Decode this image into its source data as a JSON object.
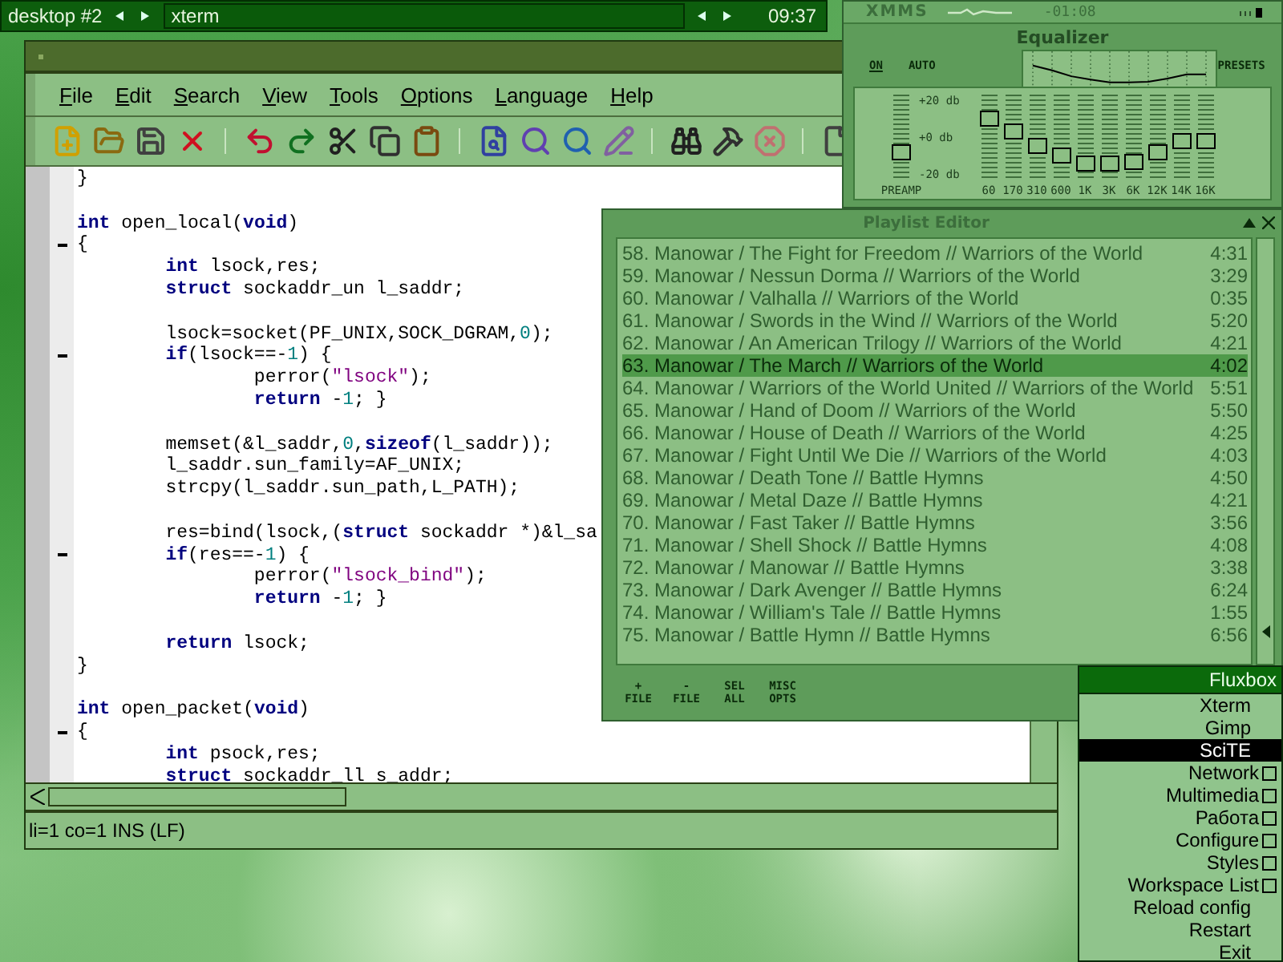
{
  "taskbar": {
    "workspace": "desktop #2",
    "task": "xterm",
    "clock": "09:37"
  },
  "editor": {
    "menu": [
      "File",
      "Edit",
      "Search",
      "View",
      "Tools",
      "Options",
      "Language",
      "Help"
    ],
    "lines": [
      {
        "kind": "code",
        "fold": false,
        "segments": [
          {
            "kind": "plain",
            "text": "}"
          }
        ]
      },
      {
        "kind": "blank",
        "fold": false
      },
      {
        "kind": "code",
        "fold": false,
        "segments": [
          {
            "kind": "kw",
            "text": "int"
          },
          {
            "kind": "plain",
            "text": " open_local("
          },
          {
            "kind": "kw",
            "text": "void"
          },
          {
            "kind": "plain",
            "text": ")"
          }
        ]
      },
      {
        "kind": "code",
        "fold": true,
        "segments": [
          {
            "kind": "plain",
            "text": "{"
          }
        ]
      },
      {
        "kind": "code",
        "fold": false,
        "segments": [
          {
            "kind": "kw",
            "text": "        int"
          },
          {
            "kind": "plain",
            "text": " lsock,res;"
          }
        ]
      },
      {
        "kind": "code",
        "fold": false,
        "segments": [
          {
            "kind": "kw",
            "text": "        struct"
          },
          {
            "kind": "plain",
            "text": " sockaddr_un l_saddr;"
          }
        ]
      },
      {
        "kind": "blank",
        "fold": false
      },
      {
        "kind": "code",
        "fold": false,
        "segments": [
          {
            "kind": "plain",
            "text": "        lsock=socket(PF_UNIX,SOCK_DGRAM,"
          },
          {
            "kind": "num",
            "text": "0"
          },
          {
            "kind": "plain",
            "text": ");"
          }
        ]
      },
      {
        "kind": "code",
        "fold": true,
        "segments": [
          {
            "kind": "kw",
            "text": "        if"
          },
          {
            "kind": "plain",
            "text": "(lsock==-"
          },
          {
            "kind": "num",
            "text": "1"
          },
          {
            "kind": "plain",
            "text": ") {"
          }
        ]
      },
      {
        "kind": "code",
        "fold": false,
        "segments": [
          {
            "kind": "plain",
            "text": "                perror("
          },
          {
            "kind": "str",
            "text": "\"lsock\""
          },
          {
            "kind": "plain",
            "text": ");"
          }
        ]
      },
      {
        "kind": "code",
        "fold": false,
        "segments": [
          {
            "kind": "kw",
            "text": "                return"
          },
          {
            "kind": "plain",
            "text": " -"
          },
          {
            "kind": "num",
            "text": "1"
          },
          {
            "kind": "plain",
            "text": "; }"
          }
        ]
      },
      {
        "kind": "blank",
        "fold": false
      },
      {
        "kind": "code",
        "fold": false,
        "segments": [
          {
            "kind": "plain",
            "text": "        memset(&l_saddr,"
          },
          {
            "kind": "num",
            "text": "0"
          },
          {
            "kind": "plain",
            "text": ","
          },
          {
            "kind": "kw",
            "text": "sizeof"
          },
          {
            "kind": "plain",
            "text": "(l_saddr));"
          }
        ]
      },
      {
        "kind": "code",
        "fold": false,
        "segments": [
          {
            "kind": "plain",
            "text": "        l_saddr.sun_family=AF_UNIX;"
          }
        ]
      },
      {
        "kind": "code",
        "fold": false,
        "segments": [
          {
            "kind": "plain",
            "text": "        strcpy(l_saddr.sun_path,L_PATH);"
          }
        ]
      },
      {
        "kind": "blank",
        "fold": false
      },
      {
        "kind": "code",
        "fold": false,
        "segments": [
          {
            "kind": "plain",
            "text": "        res=bind(lsock,("
          },
          {
            "kind": "kw",
            "text": "struct"
          },
          {
            "kind": "plain",
            "text": " sockaddr *)&l_sa"
          }
        ]
      },
      {
        "kind": "code",
        "fold": true,
        "segments": [
          {
            "kind": "kw",
            "text": "        if"
          },
          {
            "kind": "plain",
            "text": "(res==-"
          },
          {
            "kind": "num",
            "text": "1"
          },
          {
            "kind": "plain",
            "text": ") {"
          }
        ]
      },
      {
        "kind": "code",
        "fold": false,
        "segments": [
          {
            "kind": "plain",
            "text": "                perror("
          },
          {
            "kind": "str",
            "text": "\"lsock_bind\""
          },
          {
            "kind": "plain",
            "text": ");"
          }
        ]
      },
      {
        "kind": "code",
        "fold": false,
        "segments": [
          {
            "kind": "kw",
            "text": "                return"
          },
          {
            "kind": "plain",
            "text": " -"
          },
          {
            "kind": "num",
            "text": "1"
          },
          {
            "kind": "plain",
            "text": "; }"
          }
        ]
      },
      {
        "kind": "blank",
        "fold": false
      },
      {
        "kind": "code",
        "fold": false,
        "segments": [
          {
            "kind": "kw",
            "text": "        return"
          },
          {
            "kind": "plain",
            "text": " lsock;"
          }
        ]
      },
      {
        "kind": "code",
        "fold": false,
        "segments": [
          {
            "kind": "plain",
            "text": "}"
          }
        ]
      },
      {
        "kind": "blank",
        "fold": false
      },
      {
        "kind": "code",
        "fold": false,
        "segments": [
          {
            "kind": "kw",
            "text": "int"
          },
          {
            "kind": "plain",
            "text": " open_packet("
          },
          {
            "kind": "kw",
            "text": "void"
          },
          {
            "kind": "plain",
            "text": ")"
          }
        ]
      },
      {
        "kind": "code",
        "fold": true,
        "segments": [
          {
            "kind": "plain",
            "text": "{"
          }
        ]
      },
      {
        "kind": "code",
        "fold": false,
        "segments": [
          {
            "kind": "kw",
            "text": "        int"
          },
          {
            "kind": "plain",
            "text": " psock,res;"
          }
        ]
      },
      {
        "kind": "code",
        "fold": false,
        "segments": [
          {
            "kind": "kw",
            "text": "        struct"
          },
          {
            "kind": "plain",
            "text": " sockaddr_ll s_addr;"
          }
        ]
      }
    ],
    "status": "li=1 co=1 INS (LF)"
  },
  "xmms": {
    "title": "XMMS",
    "time": "-01:08",
    "equalizer": {
      "title": "Equalizer",
      "on_label": "ON",
      "on": true,
      "auto_label": "AUTO",
      "auto": false,
      "presets_label": "PRESETS",
      "scale": [
        "+20 db",
        "+0 db",
        "-20 db"
      ],
      "preamp": {
        "label": "PREAMP",
        "level": 0.34
      },
      "bands": [
        {
          "label": "60",
          "level": 0.73
        },
        {
          "label": "170",
          "level": 0.58
        },
        {
          "label": "310",
          "level": 0.4
        },
        {
          "label": "600",
          "level": 0.3
        },
        {
          "label": "1K",
          "level": 0.21
        },
        {
          "label": "3K",
          "level": 0.21
        },
        {
          "label": "6K",
          "level": 0.23
        },
        {
          "label": "12K",
          "level": 0.33
        },
        {
          "label": "14K",
          "level": 0.46
        },
        {
          "label": "16K",
          "level": 0.46
        }
      ]
    }
  },
  "playlist": {
    "title": "Playlist Editor",
    "rows": [
      {
        "title": "58. Manowar / The Fight for Freedom // Warriors of the World",
        "duration": "4:31",
        "selected": false
      },
      {
        "title": "59. Manowar / Nessun Dorma // Warriors of the World",
        "duration": "3:29",
        "selected": false
      },
      {
        "title": "60. Manowar / Valhalla // Warriors of the World",
        "duration": "0:35",
        "selected": false
      },
      {
        "title": "61. Manowar / Swords in the Wind // Warriors of the World",
        "duration": "5:20",
        "selected": false
      },
      {
        "title": "62. Manowar / An American Trilogy // Warriors of the World",
        "duration": "4:21",
        "selected": false
      },
      {
        "title": "63. Manowar / The March // Warriors of the World",
        "duration": "4:02",
        "selected": true
      },
      {
        "title": "64. Manowar / Warriors of the World United // Warriors of the World",
        "duration": "5:51",
        "selected": false
      },
      {
        "title": "65. Manowar / Hand of Doom // Warriors of the World",
        "duration": "5:50",
        "selected": false
      },
      {
        "title": "66. Manowar / House of Death // Warriors of the World",
        "duration": "4:25",
        "selected": false
      },
      {
        "title": "67. Manowar / Fight Until We Die // Warriors of the World",
        "duration": "4:03",
        "selected": false
      },
      {
        "title": "68. Manowar / Death Tone // Battle Hymns",
        "duration": "4:50",
        "selected": false
      },
      {
        "title": "69. Manowar / Metal Daze // Battle Hymns",
        "duration": "4:21",
        "selected": false
      },
      {
        "title": "70. Manowar / Fast Taker // Battle Hymns",
        "duration": "3:56",
        "selected": false
      },
      {
        "title": "71. Manowar / Shell Shock // Battle Hymns",
        "duration": "4:08",
        "selected": false
      },
      {
        "title": "72. Manowar / Manowar // Battle Hymns",
        "duration": "3:38",
        "selected": false
      },
      {
        "title": "73. Manowar / Dark Avenger // Battle Hymns",
        "duration": "6:24",
        "selected": false
      },
      {
        "title": "74. Manowar / William's Tale // Battle Hymns",
        "duration": "1:55",
        "selected": false
      },
      {
        "title": "75. Manowar / Battle Hymn // Battle Hymns",
        "duration": "6:56",
        "selected": false
      }
    ],
    "buttons": [
      {
        "line_1": "+",
        "line_2": "FILE"
      },
      {
        "line_1": "-",
        "line_2": "FILE"
      },
      {
        "line_1": "SEL",
        "line_2": "ALL"
      },
      {
        "line_1": "MISC",
        "line_2": "OPTS"
      }
    ]
  },
  "menu": {
    "title": "Fluxbox",
    "items": [
      {
        "label": "Xterm",
        "submenu": false,
        "selected": false
      },
      {
        "label": "Gimp",
        "submenu": false,
        "selected": false
      },
      {
        "label": "SciTE",
        "submenu": false,
        "selected": true
      },
      {
        "label": "Network",
        "submenu": true,
        "selected": false
      },
      {
        "label": "Multimedia",
        "submenu": true,
        "selected": false
      },
      {
        "label": "Работа",
        "submenu": true,
        "selected": false
      },
      {
        "label": "Configure",
        "submenu": true,
        "selected": false
      },
      {
        "label": "Styles",
        "submenu": true,
        "selected": false
      },
      {
        "label": "Workspace List",
        "submenu": true,
        "selected": false
      },
      {
        "label": "Reload config",
        "submenu": false,
        "selected": false
      },
      {
        "label": "Restart",
        "submenu": false,
        "selected": false
      },
      {
        "label": "Exit",
        "submenu": false,
        "selected": false
      }
    ]
  }
}
